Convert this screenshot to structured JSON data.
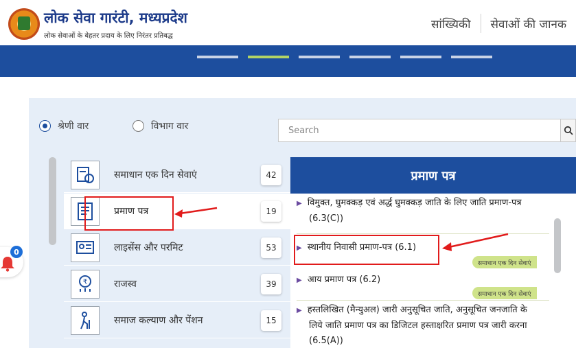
{
  "header": {
    "title": "लोक सेवा गारंटी, मध्यप्रदेश",
    "tagline": "लोक सेवाओं के बेहतर प्रदाय के लिए निरंतर प्रतिबद्ध",
    "nav": [
      "सांख्यिकी",
      "सेवाओं की जानक"
    ]
  },
  "filters": {
    "options": [
      {
        "label": "श्रेणी वार",
        "checked": true
      },
      {
        "label": "विभाग वार",
        "checked": false
      }
    ],
    "search_placeholder": "Search"
  },
  "categories": [
    {
      "label": "समाधान एक दिन सेवाएं",
      "count": "42",
      "icon": "one-day-service-icon"
    },
    {
      "label": "प्रमाण पत्र",
      "count": "19",
      "icon": "certificate-icon",
      "selected": true
    },
    {
      "label": "लाइसेंस और परमिट",
      "count": "53",
      "icon": "license-icon"
    },
    {
      "label": "राजस्व",
      "count": "39",
      "icon": "revenue-icon"
    },
    {
      "label": "समाज कल्याण और पेंशन",
      "count": "15",
      "icon": "welfare-icon"
    }
  ],
  "services": {
    "title": "प्रमाण पत्र",
    "items": [
      {
        "line1": "विमुक्त, घुमक्कड़ एवं अर्द्ध घुमक्कड़ जाति के लिए जाति प्रमाण-पत्र",
        "line2": "(6.3(C))",
        "line3": ""
      },
      {
        "line1": "स्थानीय निवासी प्रमाण-पत्र (6.1)",
        "line2": "",
        "line3": "",
        "tag": "समाधान एक दिन सेवाएं"
      },
      {
        "line1": "आय प्रमाण पत्र (6.2)",
        "line2": "",
        "line3": "",
        "tag": "समाधान एक दिन सेवाएं"
      },
      {
        "line1": "हस्तलिखित (मैन्युअल) जारी अनुसूचित जाति, अनुसूचित जनजाति के",
        "line2": "लिये जाति प्रमाण पत्र का डिजिटल हस्ताक्षरित प्रमाण पत्र जारी करना",
        "line3": "(6.5(A))"
      }
    ]
  },
  "notification": {
    "count": "0"
  },
  "colors": {
    "brand_blue": "#1d4e9e",
    "tag_green": "#cfe38a",
    "annotation_red": "#e11b1b"
  }
}
